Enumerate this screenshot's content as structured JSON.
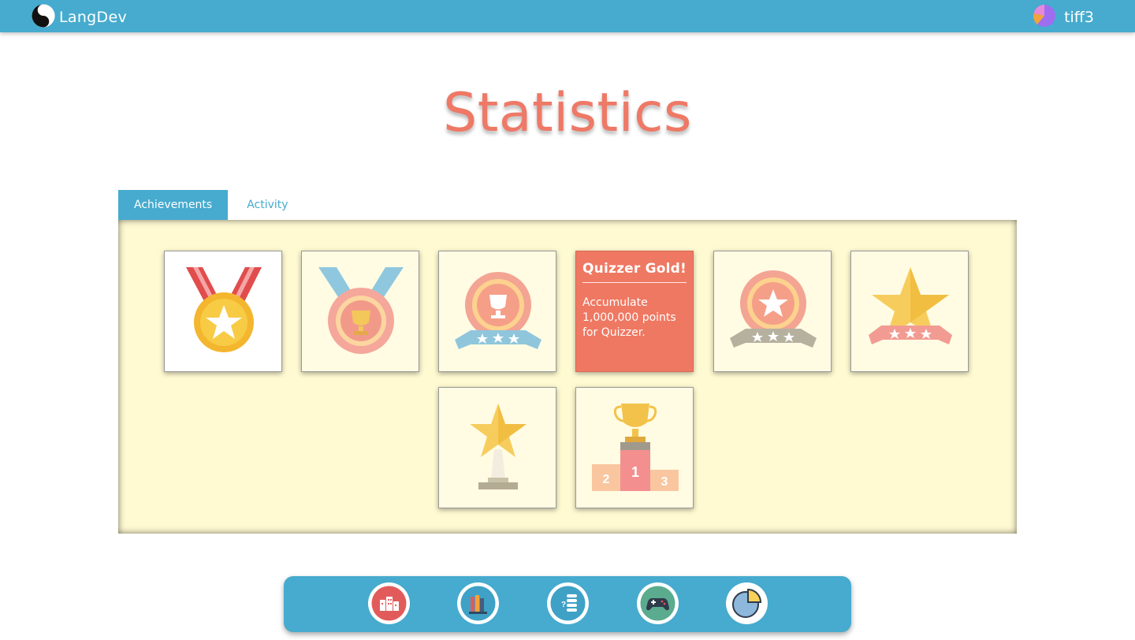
{
  "header": {
    "brand": "LangDev",
    "username": "tiff3",
    "logo_icon": "yin-yang-icon",
    "avatar_icon": "pie-avatar-icon",
    "bar_color": "#46abce"
  },
  "page": {
    "title": "Statistics",
    "title_color": "#ee7966"
  },
  "tabs": [
    {
      "label": "Achievements",
      "active": true
    },
    {
      "label": "Activity",
      "active": false
    }
  ],
  "achievements": [
    {
      "icon": "red-ribbon-gold-medal-icon",
      "earned": true
    },
    {
      "icon": "blue-ribbon-trophy-medal-icon",
      "earned": false
    },
    {
      "icon": "trophy-rosette-blue-banner-icon",
      "earned": false
    },
    {
      "icon": "hover-card",
      "earned": false,
      "hover_title": "Quizzer Gold!",
      "hover_desc": "Accumulate 1,000,000 points for Quizzer."
    },
    {
      "icon": "star-rosette-gray-banner-icon",
      "earned": false
    },
    {
      "icon": "star-pink-banner-icon",
      "earned": false
    },
    {
      "icon": "star-trophy-icon",
      "earned": false
    },
    {
      "icon": "podium-trophy-icon",
      "earned": false
    }
  ],
  "dock": [
    {
      "icon": "city-buildings-icon",
      "color": "#e25b5b"
    },
    {
      "icon": "books-icon",
      "color": "#3fa1c6"
    },
    {
      "icon": "quiz-list-icon",
      "color": "#3fa1c6"
    },
    {
      "icon": "gamepad-icon",
      "color": "#5bab8f"
    },
    {
      "icon": "pie-chart-icon",
      "color": "#8db8dc"
    }
  ],
  "colors": {
    "panel_background": "#fffad2",
    "hover_card": "#ef7862",
    "dock": "#46abce"
  }
}
